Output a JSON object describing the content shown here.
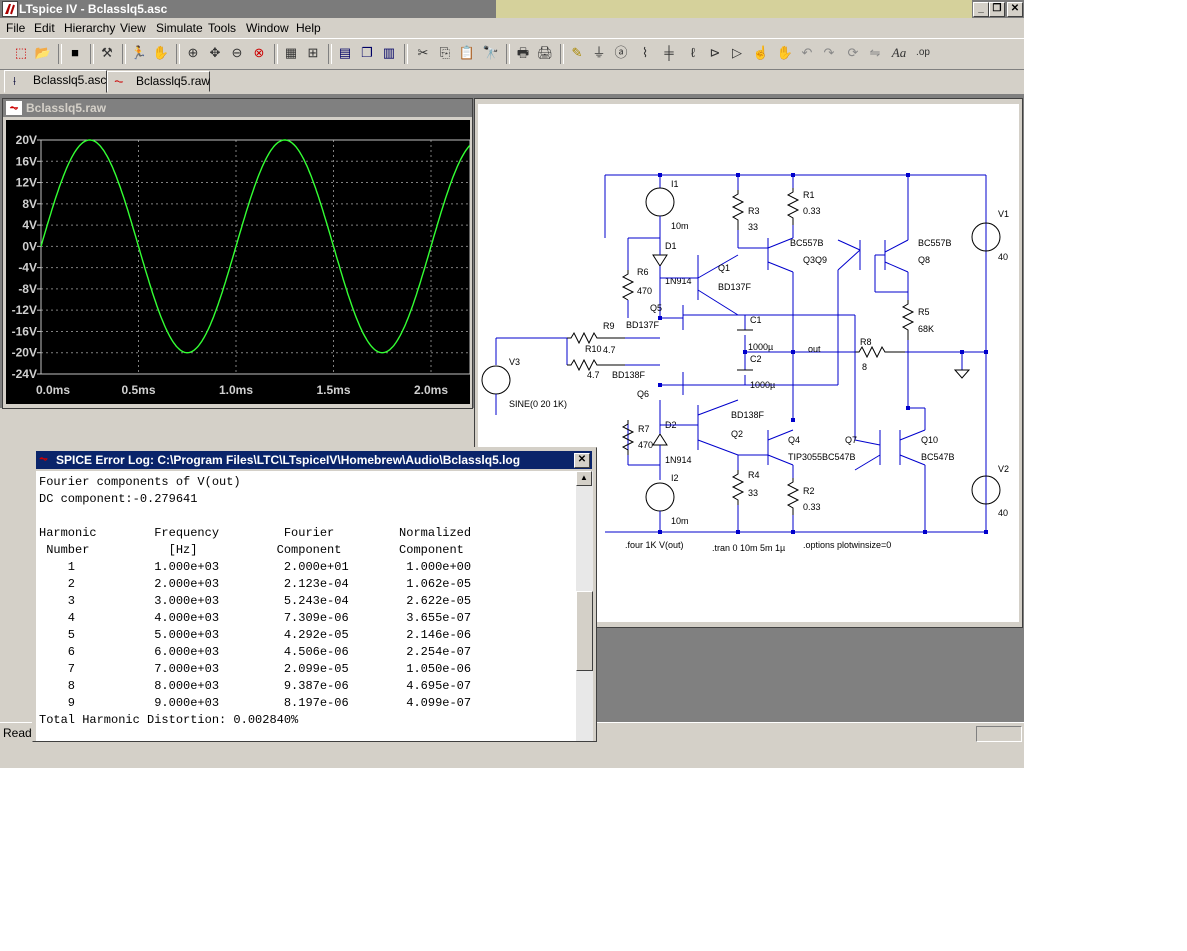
{
  "app": {
    "title": "LTspice IV - Bclasslq5.asc"
  },
  "menu": [
    "File",
    "Edit",
    "Hierarchy",
    "View",
    "Simulate",
    "Tools",
    "Window",
    "Help"
  ],
  "tabs": [
    {
      "label": "Bclasslq5.asc"
    },
    {
      "label": "Bclasslq5.raw"
    }
  ],
  "plot": {
    "title": "Bclasslq5.raw",
    "color_trace": "#33ff33",
    "color_bg": "#000000",
    "yticks": [
      "20V",
      "16V",
      "12V",
      "8V",
      "4V",
      "0V",
      "-4V",
      "-8V",
      "-12V",
      "-16V",
      "-20V",
      "-24V"
    ],
    "xticks": [
      "0.0ms",
      "0.5ms",
      "1.0ms",
      "1.5ms",
      "2.0ms"
    ]
  },
  "chart_data": {
    "type": "line",
    "title": "",
    "xlabel": "",
    "ylabel": "",
    "xlim": [
      0,
      2.2
    ],
    "ylim": [
      -24,
      20
    ],
    "series": [
      {
        "name": "",
        "amplitude": 20,
        "frequency_khz": 1,
        "offset": 0,
        "x": [
          0,
          0.25,
          0.5,
          0.75,
          1.0,
          1.25,
          1.5,
          1.75,
          2.0,
          2.2
        ],
        "values": [
          0,
          20,
          0,
          -20,
          0,
          20,
          0,
          -20,
          0,
          19
        ]
      }
    ],
    "grid": true
  },
  "schematic": {
    "labels": {
      "I1": "I1",
      "I1v": "10m",
      "D1": "D1",
      "D1m": "1N914",
      "R6": "R6",
      "R6v": "470",
      "R3": "R3",
      "R3v": "33",
      "R1": "R1",
      "R1v": "0.33",
      "Q1": "Q1",
      "Q1m": "BD137F",
      "Q3": "BC557B",
      "Q3b": "Q3Q9",
      "Q3m": "BC557B",
      "Q8": "Q8",
      "Q8m": "BC557B",
      "V1": "V1",
      "V1v": "40",
      "Q5": "Q5",
      "Q5m": "BD137F",
      "R9": "R9",
      "R9v": "4.7",
      "R10": "R10",
      "R10v": "4.7",
      "Q6": "Q6",
      "Q6m": "BD138F",
      "V3": "V3",
      "V3v": "SINE(0 20 1K)",
      "C1": "C1",
      "C1v": "1000µ",
      "C2": "C2",
      "C2v": "1000µ",
      "out": "out",
      "R8": "R8",
      "R8v": "8",
      "R5": "R5",
      "R5v": "68K",
      "R7": "R7",
      "R7v": "470",
      "D2": "D2",
      "D2m": "1N914",
      "Q2": "Q2",
      "Q2m": "BD138F",
      "Q4": "Q4",
      "Q4m": "TIP3055",
      "Q7": "Q7",
      "Q7m": "BC547B",
      "Q10": "Q10",
      "Q10m": "BC547B",
      "I2": "I2",
      "I2v": "10m",
      "R4": "R4",
      "R4v": "33",
      "R2": "R2",
      "R2v": "0.33",
      "V2": "V2",
      "V2v": "40",
      "d1": ".four 1K V(out)",
      "d2": ".tran 0 10m 5m 1µ",
      "d3": ".options plotwinsize=0"
    },
    "wire_color": "#0000cc"
  },
  "errlog": {
    "title": "SPICE Error Log: C:\\Program Files\\LTC\\LTspiceIV\\Homebrew\\Audio\\Bclasslq5.log",
    "lines": [
      "Fourier components of V(out)",
      "DC component:-0.279641",
      "",
      "Harmonic        Frequency         Fourier         Normalized",
      " Number           [Hz]           Component        Component",
      "    1           1.000e+03         2.000e+01        1.000e+00",
      "    2           2.000e+03         2.123e-04        1.062e-05",
      "    3           3.000e+03         5.243e-04        2.622e-05",
      "    4           4.000e+03         7.309e-06        3.655e-07",
      "    5           5.000e+03         4.292e-05        2.146e-06",
      "    6           6.000e+03         4.506e-06        2.254e-07",
      "    7           7.000e+03         2.099e-05        1.050e-06",
      "    8           8.000e+03         9.387e-06        4.695e-07",
      "    9           9.000e+03         8.197e-06        4.099e-07",
      "Total Harmonic Distortion: 0.002840%"
    ]
  },
  "status": {
    "text": "Ready"
  }
}
